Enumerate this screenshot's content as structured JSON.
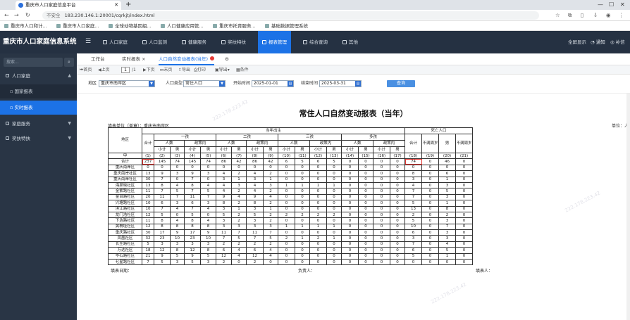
{
  "browser": {
    "tab_title": "重庆市人口家庭信息平台",
    "url_warning": "不安全",
    "url": "183.230.146.1:20001/cqrkjt/index.html",
    "bookmarks": [
      "重庆市人口和计...",
      "重庆市人口家庭...",
      "全球动物基因组...",
      "人口健康应用管...",
      "重庆市托育服务...",
      "基础数据管理系统"
    ]
  },
  "app": {
    "title": "重庆市人口家庭信息系统",
    "menu": [
      {
        "label": "人口家庭",
        "active": false
      },
      {
        "label": "人口监测",
        "active": false
      },
      {
        "label": "健康服务",
        "active": false
      },
      {
        "label": "奖扶特扶",
        "active": false
      },
      {
        "label": "报表管理",
        "active": true
      },
      {
        "label": "综合查询",
        "active": false
      },
      {
        "label": "其他",
        "active": false
      }
    ],
    "right_tools": [
      "全屏显示",
      "通知",
      "补信"
    ]
  },
  "sidebar": {
    "search_placeholder": "搜索...",
    "items": [
      {
        "label": "人口家庭",
        "expanded": true
      },
      {
        "label": "国家报表",
        "sub": true,
        "active": false
      },
      {
        "label": "实时报表",
        "sub": true,
        "active": true
      },
      {
        "label": "家庭服务",
        "expanded": false
      },
      {
        "label": "奖扶特扶",
        "expanded": false
      }
    ]
  },
  "page_tabs": [
    {
      "label": "工作台",
      "closable": false,
      "active": false
    },
    {
      "label": "实时报表",
      "closable": true,
      "active": false
    },
    {
      "label": "人口自然变动报表(当年)",
      "closable": false,
      "active": true,
      "has_dot": true
    }
  ],
  "toolbar": {
    "first": "首页",
    "prev": "上页",
    "page_value": "1",
    "page_of": "/1",
    "next": "下页",
    "last": "末页",
    "export": "导出",
    "print": "打印",
    "export_menu": "导出",
    "settings": "条件"
  },
  "filters": {
    "area_label": "地区",
    "area_value": "重庆市南岸区",
    "type_label": "人口类型",
    "type_value": "常住人口",
    "start_label": "开始时间",
    "start_value": "2025-01-01",
    "end_label": "结束时间",
    "end_value": "2025-03-31",
    "query_button": "查询"
  },
  "report": {
    "title": "常住人口自然变动报表（当年）",
    "unit_left": "填表单位（盖章）：重庆市南岸区",
    "unit_right": "单位：人",
    "group_current": "当年出生",
    "group_death": "死亡人口",
    "col_area": "地区",
    "col_total": "合计",
    "col_people": "人数",
    "col_in_policy": "政策内",
    "col_subtotal": "小计",
    "col_male": "男",
    "col_unlisted": "不满周岁",
    "births": [
      "一孩",
      "二孩",
      "三孩",
      "多孩"
    ],
    "code_label": "甲",
    "col_codes": [
      "(1)",
      "(2)",
      "(3)",
      "(4)",
      "(5)",
      "(6)",
      "(7)",
      "(8)",
      "(9)",
      "(10)",
      "(11)",
      "(12)",
      "(13)",
      "(14)",
      "(15)",
      "(16)",
      "(17)",
      "(18)",
      "(19)",
      "(20)",
      "(21)"
    ],
    "rows": [
      {
        "name": "合计",
        "v": [
          "237",
          "145",
          "74",
          "145",
          "74",
          "86",
          "42",
          "86",
          "42",
          "6",
          "5",
          "6",
          "5",
          "0",
          "0",
          "0",
          "0",
          "74",
          "0",
          "46",
          "0"
        ]
      },
      {
        "name": "重庆南岸区",
        "v": [
          "0",
          "0",
          "0",
          "0",
          "0",
          "0",
          "0",
          "0",
          "0",
          "0",
          "0",
          "0",
          "0",
          "0",
          "0",
          "0",
          "0",
          "0",
          "0",
          "0",
          "0"
        ]
      },
      {
        "name": "重庆南岸社区",
        "v": [
          "13",
          "9",
          "3",
          "9",
          "3",
          "4",
          "2",
          "4",
          "2",
          "0",
          "0",
          "0",
          "0",
          "0",
          "0",
          "0",
          "0",
          "8",
          "0",
          "6",
          "0"
        ]
      },
      {
        "name": "重庆南岸社区",
        "v": [
          "30",
          "7",
          "0",
          "7",
          "0",
          "3",
          "1",
          "3",
          "1",
          "0",
          "0",
          "0",
          "0",
          "0",
          "0",
          "0",
          "0",
          "3",
          "0",
          "1",
          "0"
        ]
      },
      {
        "name": "海棠晓社区",
        "v": [
          "13",
          "8",
          "4",
          "8",
          "4",
          "4",
          "3",
          "4",
          "3",
          "1",
          "1",
          "1",
          "1",
          "0",
          "0",
          "0",
          "0",
          "4",
          "0",
          "3",
          "0"
        ]
      },
      {
        "name": "金紫路社区",
        "v": [
          "11",
          "7",
          "5",
          "7",
          "5",
          "4",
          "2",
          "4",
          "2",
          "0",
          "0",
          "0",
          "0",
          "0",
          "0",
          "0",
          "0",
          "7",
          "0",
          "5",
          "0"
        ]
      },
      {
        "name": "金台路社区",
        "v": [
          "20",
          "11",
          "7",
          "11",
          "7",
          "9",
          "4",
          "9",
          "4",
          "0",
          "0",
          "0",
          "0",
          "0",
          "0",
          "0",
          "0",
          "7",
          "0",
          "3",
          "0"
        ]
      },
      {
        "name": "兴塘路社区",
        "v": [
          "10",
          "6",
          "3",
          "6",
          "3",
          "8",
          "2",
          "8",
          "2",
          "0",
          "0",
          "0",
          "0",
          "0",
          "0",
          "0",
          "0",
          "5",
          "0",
          "1",
          "0"
        ]
      },
      {
        "name": "滨江路社区",
        "v": [
          "10",
          "7",
          "4",
          "7",
          "4",
          "3",
          "1",
          "3",
          "1",
          "0",
          "0",
          "0",
          "0",
          "0",
          "0",
          "0",
          "0",
          "13",
          "0",
          "8",
          "0"
        ]
      },
      {
        "name": "龙门浩社区",
        "v": [
          "12",
          "5",
          "0",
          "5",
          "0",
          "5",
          "2",
          "5",
          "2",
          "2",
          "2",
          "2",
          "2",
          "0",
          "0",
          "0",
          "0",
          "2",
          "0",
          "2",
          "0"
        ]
      },
      {
        "name": "下浩路社区",
        "v": [
          "11",
          "8",
          "4",
          "8",
          "4",
          "3",
          "2",
          "3",
          "2",
          "0",
          "0",
          "0",
          "0",
          "0",
          "0",
          "0",
          "0",
          "5",
          "0",
          "3",
          "0"
        ]
      },
      {
        "name": "黄桷垭社区",
        "v": [
          "12",
          "8",
          "8",
          "8",
          "8",
          "3",
          "3",
          "3",
          "3",
          "1",
          "1",
          "1",
          "1",
          "0",
          "0",
          "0",
          "0",
          "10",
          "0",
          "7",
          "0"
        ]
      },
      {
        "name": "重庆路社区",
        "v": [
          "30",
          "17",
          "9",
          "17",
          "9",
          "11",
          "7",
          "11",
          "7",
          "0",
          "0",
          "0",
          "0",
          "0",
          "0",
          "0",
          "0",
          "6",
          "0",
          "3",
          "0"
        ]
      },
      {
        "name": "凤凰社区",
        "v": [
          "32",
          "23",
          "10",
          "23",
          "10",
          "7",
          "5",
          "7",
          "5",
          "2",
          "1",
          "2",
          "1",
          "0",
          "0",
          "0",
          "0",
          "3",
          "0",
          "3",
          "0"
        ]
      },
      {
        "name": "长生路社区",
        "v": [
          "5",
          "3",
          "3",
          "3",
          "3",
          "2",
          "2",
          "2",
          "2",
          "0",
          "0",
          "0",
          "0",
          "0",
          "0",
          "0",
          "0",
          "7",
          "0",
          "4",
          "0"
        ]
      },
      {
        "name": "万达社区",
        "v": [
          "18",
          "12",
          "8",
          "12",
          "8",
          "6",
          "4",
          "6",
          "4",
          "0",
          "0",
          "0",
          "0",
          "0",
          "0",
          "0",
          "0",
          "6",
          "0",
          "5",
          "0"
        ]
      },
      {
        "name": "华石路社区",
        "v": [
          "21",
          "9",
          "5",
          "9",
          "5",
          "12",
          "4",
          "12",
          "4",
          "0",
          "0",
          "0",
          "0",
          "0",
          "0",
          "0",
          "0",
          "5",
          "0",
          "1",
          "0"
        ]
      },
      {
        "name": "七星路社区",
        "v": [
          "7",
          "5",
          "3",
          "5",
          "3",
          "2",
          "0",
          "2",
          "0",
          "0",
          "0",
          "0",
          "0",
          "0",
          "0",
          "0",
          "0",
          "0",
          "0",
          "0",
          "0"
        ]
      }
    ],
    "sign_filler": "填表日期：",
    "sign_owner": "负责人：",
    "sign_maker": "填表人："
  },
  "watermark": "222.178.223.42"
}
